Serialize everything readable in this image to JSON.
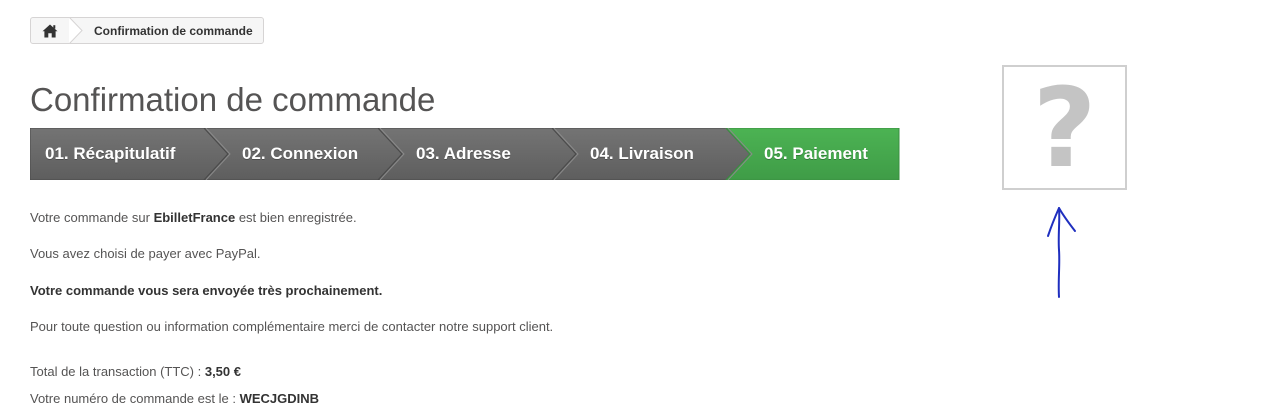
{
  "breadcrumb": {
    "home_icon": "home-icon",
    "current": "Confirmation de commande"
  },
  "page": {
    "title": "Confirmation de commande"
  },
  "steps": [
    {
      "label": "01. Récapitulatif",
      "state": "done",
      "color": "#6b6b6b"
    },
    {
      "label": "02. Connexion",
      "state": "done",
      "color": "#6b6b6b"
    },
    {
      "label": "03. Adresse",
      "state": "done",
      "color": "#6b6b6b"
    },
    {
      "label": "04. Livraison",
      "state": "done",
      "color": "#6b6b6b"
    },
    {
      "label": "05. Paiement",
      "state": "current",
      "color": "#46a74e"
    }
  ],
  "message": {
    "line1_prefix": "Votre commande sur ",
    "line1_shop": "EbilletFrance",
    "line1_suffix": " est bien enregistrée.",
    "line2": "Vous avez choisi de payer avec PayPal.",
    "line3": "Votre commande vous sera envoyée très prochainement.",
    "line4": "Pour toute question ou information complémentaire merci de contacter notre support client.",
    "total_label": "Total de la transaction (TTC) : ",
    "total_value": "3,50 €",
    "order_label": "Votre numéro de commande est le : ",
    "order_value": "WECJGDINB"
  },
  "image_placeholder": {
    "glyph": "?",
    "icon": "question-mark-icon"
  },
  "annotation": {
    "icon": "hand-drawn-arrow-up-icon",
    "color": "#1f2fbf"
  }
}
